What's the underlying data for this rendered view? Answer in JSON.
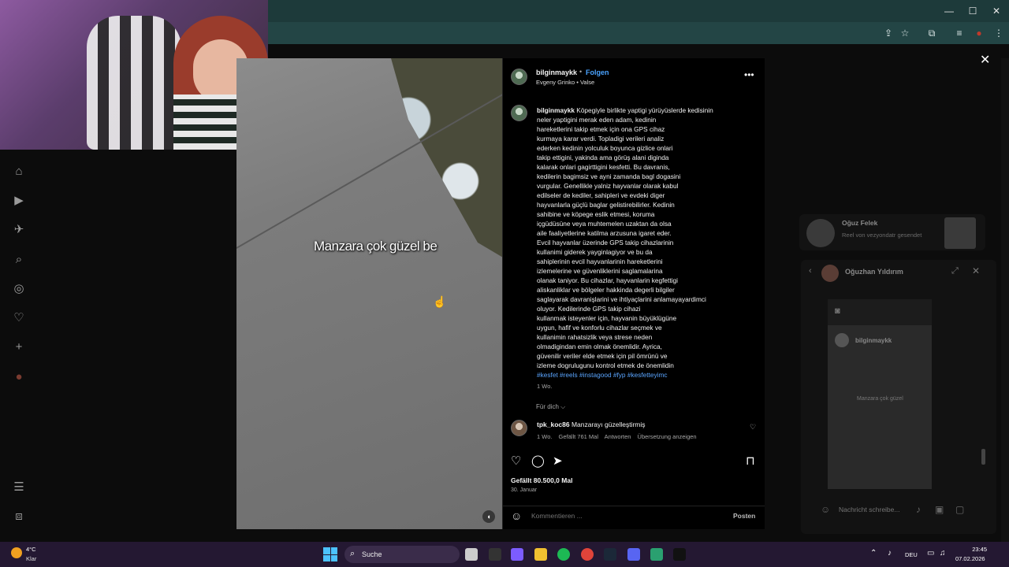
{
  "colors": {
    "link": "#4aa3ff",
    "hashtag": "#5aa5ff",
    "panel_bg": "#000000",
    "taskbar_bg": "#241832",
    "browser_chrome": "#1d3a3a"
  },
  "browser": {
    "window_controls": [
      "—",
      "☐",
      "✕"
    ],
    "toolbar_icons": [
      "install-icon",
      "star-icon",
      "extensions-icon",
      "media-icon",
      "profile-icon",
      "menu-icon"
    ]
  },
  "video": {
    "overlay_text": "Manzara çok güzel be"
  },
  "post": {
    "username": "bilginmaykk",
    "dot": "•",
    "follow": "Folgen",
    "audio": "Evgeny Grinko • Valse",
    "caption_user": "bilginmaykk",
    "caption_lines": [
      "Köpegiyle birlikte yaptigi yürüyüslerde kedisinin",
      "neler yaptigini merak eden adam, kedinin",
      "hareketlerini takip etmek için ona GPS cihaz",
      "kurmaya karar verdi. Topladigi verileri analiz",
      "ederken kedinin yolculuk boyunca gizlice onlari",
      "takip ettigini, yakinda ama görüş alani diginda",
      "kalarak onlari gagirttigini kesfetti. Bu davranis,",
      "kedilerin bagimsiz ve ayni zamanda bagl dogasini",
      "vurgular. Genellikle yalniz hayvanlar olarak kabul",
      "edilseler de kediler, sahipleri ve evdeki diger",
      "hayvanlarla güçlü baglar gelistirebilirler. Kedinin",
      "sahibine ve köpege eslik etmesi, koruma",
      "içgüdüsüne veya muhtemelen uzaktan da olsa",
      "aile faaliyetlerine katilma arzusuna igaret eder.",
      "Evcil hayvanlar üzerinde GPS takip cihazlarinin",
      "kullanimi giderek yayginlagiyor ve bu da",
      "sahiplerinin evcil hayvanlarinin hareketlerini",
      "izlemelerine ve güvenliklerini saglamalarina",
      "olanak taniyor. Bu cihazlar, hayvanlarin kegfettigi",
      "aliskanliklar ve bölgeler hakkinda degerli bilgiler",
      "saglayarak davranişlarini ve ihtiyaçlarini anlamayayardimci",
      "oluyor. Kedilerinde GPS takip cihazi",
      "kullanmak isteyenler için, hayvanin büyüklügüne",
      "uygun, hafif ve konforlu cihazlar seçmek ve",
      "kullanimin rahatsizlik veya strese neden",
      "olmadigindan emin olmak önemlidir. Ayrica,",
      "güvenilir veriler elde etmek için pil ömrünü ve",
      "izleme dogrulugunu kontrol etmek de önemlidin"
    ],
    "hashtags": "#kesfet #reels #instagood #fyp #kesfetteyimc",
    "caption_age": "1 Wo.",
    "for_you": "Für dich ⌵",
    "comment": {
      "user": "tpk_koc86",
      "text": "Manzarayı güzelleştirmiş",
      "age": "1 Wo.",
      "likes": "Gefällt 761 Mal",
      "reply": "Antworten",
      "translate": "Übersetzung anzeigen"
    },
    "likes_total": "Gefällt 80.500,0 Mal",
    "date": "30. Januar",
    "comment_placeholder": "Kommentieren ...",
    "post_button": "Posten"
  },
  "dm": {
    "notif_name": "Oğuz Felek",
    "notif_text": "Reel von vezyondatr gesendet",
    "chat_name": "Oğuzhan Yıldırım",
    "reel_user": "bilginmaykk",
    "reel_caption": "Manzara çok güzel",
    "input_placeholder": "Nachricht schreibe..."
  },
  "taskbar": {
    "temp": "4°C",
    "weather": "Klar",
    "search": "Suche",
    "lang": "DEU",
    "time": "23:45",
    "date": "07.02.2026"
  }
}
